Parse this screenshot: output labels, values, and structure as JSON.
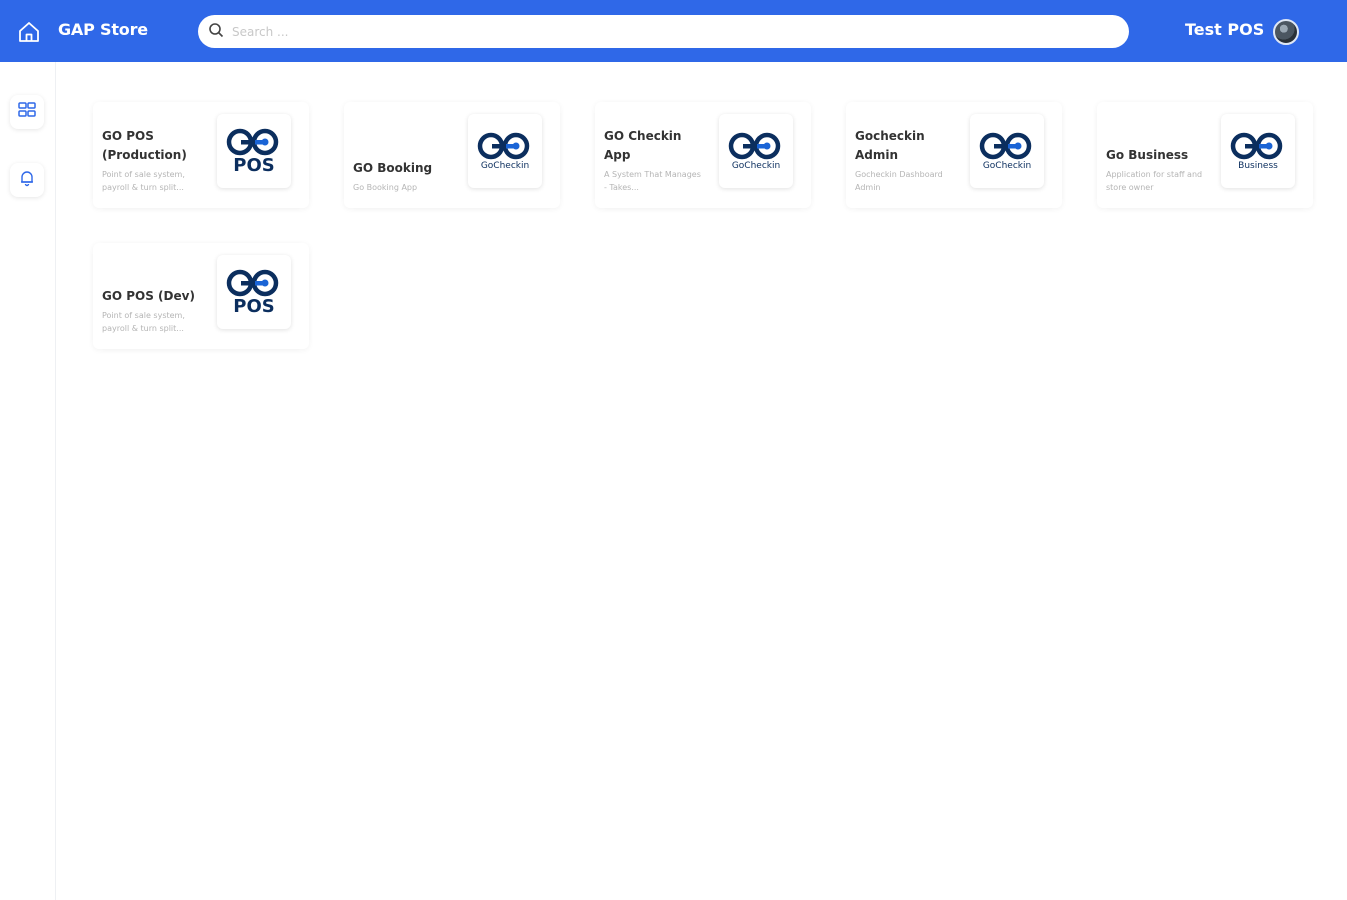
{
  "header": {
    "brand": "GAP Store",
    "search_placeholder": "Search ...",
    "user_name": "Test POS"
  },
  "colors": {
    "accent": "#2f68e8",
    "logo_dark": "#0b2e5e",
    "logo_blue": "#1a64d6"
  },
  "sidebar": {
    "items": [
      {
        "icon": "apps-grid-icon"
      },
      {
        "icon": "bell-icon"
      }
    ]
  },
  "apps": [
    {
      "title": "GO POS (Production)",
      "description": "Point of sale system, payroll & turn split...",
      "logo_text": "POS"
    },
    {
      "title": "GO Booking",
      "description": "Go Booking App",
      "logo_text": "GoCheckin"
    },
    {
      "title": "GO Checkin App",
      "description": "A System That Manages - Takes...",
      "logo_text": "GoCheckin"
    },
    {
      "title": "Gocheckin Admin",
      "description": "Gocheckin Dashboard Admin",
      "logo_text": "GoCheckin"
    },
    {
      "title": "Go Business",
      "description": "Application for staff and store owner",
      "logo_text": "Business"
    },
    {
      "title": "GO POS (Dev)",
      "description": "Point of sale system, payroll & turn split...",
      "logo_text": "POS"
    }
  ]
}
